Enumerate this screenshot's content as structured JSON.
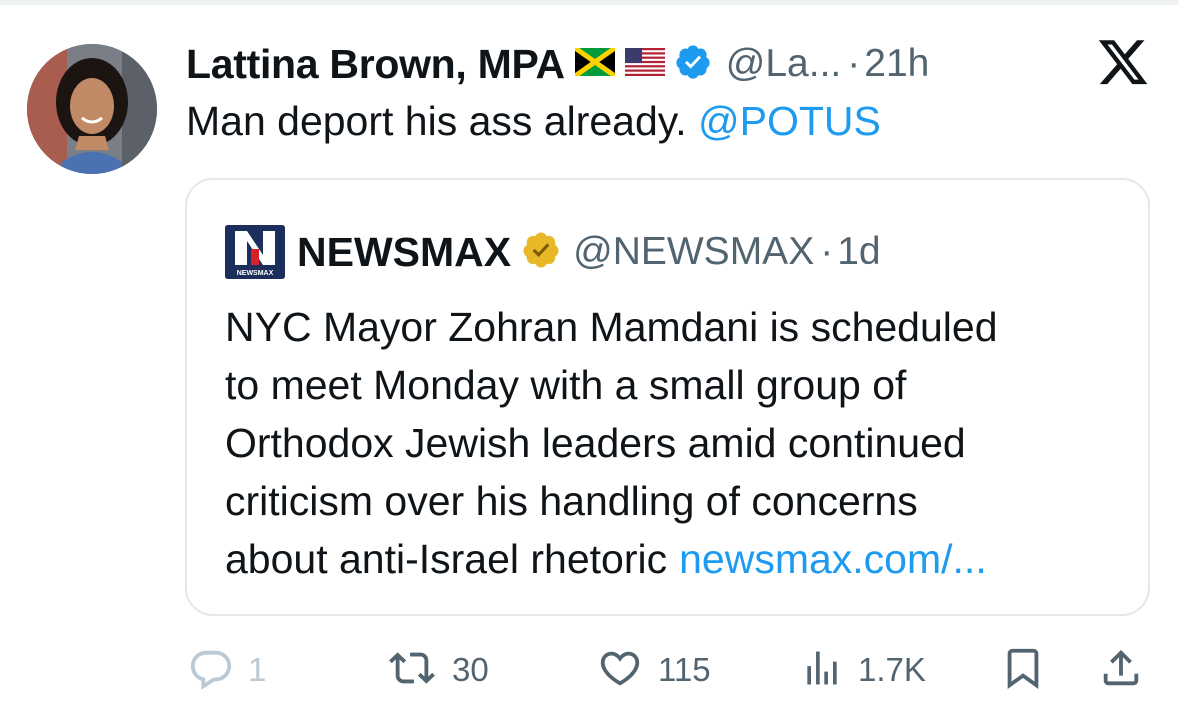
{
  "tweet": {
    "author_name": "Lattina Brown, MPA",
    "handle": "@La...",
    "separator": "·",
    "time": "21h",
    "text_prefix": "Man deport his ass already. ",
    "mention": "@POTUS"
  },
  "quote": {
    "logo_letter": "N",
    "logo_caption": "NEWSMAX",
    "author_name": "NEWSMAX",
    "handle": "@NEWSMAX",
    "separator": "·",
    "time": "1d",
    "lines": [
      "NYC Mayor Zohran Mamdani is scheduled",
      "to meet Monday with a small group of",
      "Orthodox Jewish leaders amid continued",
      "criticism over his handling of concerns",
      "about anti-Israel rhetoric"
    ],
    "link": "newsmax.com/..."
  },
  "actions": {
    "reply_count": "1",
    "retweet_count": "30",
    "like_count": "115",
    "views_count": "1.7K"
  },
  "icons": {
    "x_logo": "x-logo-icon",
    "verified": "verified-badge-icon",
    "gold_verified": "gold-verified-badge-icon",
    "reply": "reply-icon",
    "retweet": "retweet-icon",
    "like": "heart-icon",
    "views": "views-icon",
    "bookmark": "bookmark-icon",
    "share": "share-icon"
  },
  "colors": {
    "accent": "#1d9bf0",
    "text": "#0f1419",
    "secondary": "#536471",
    "muted_reply": "#b9cad6",
    "gold": "#e8b829",
    "newsmax_blue": "#1c2e5c",
    "newsmax_red": "#d72027"
  }
}
